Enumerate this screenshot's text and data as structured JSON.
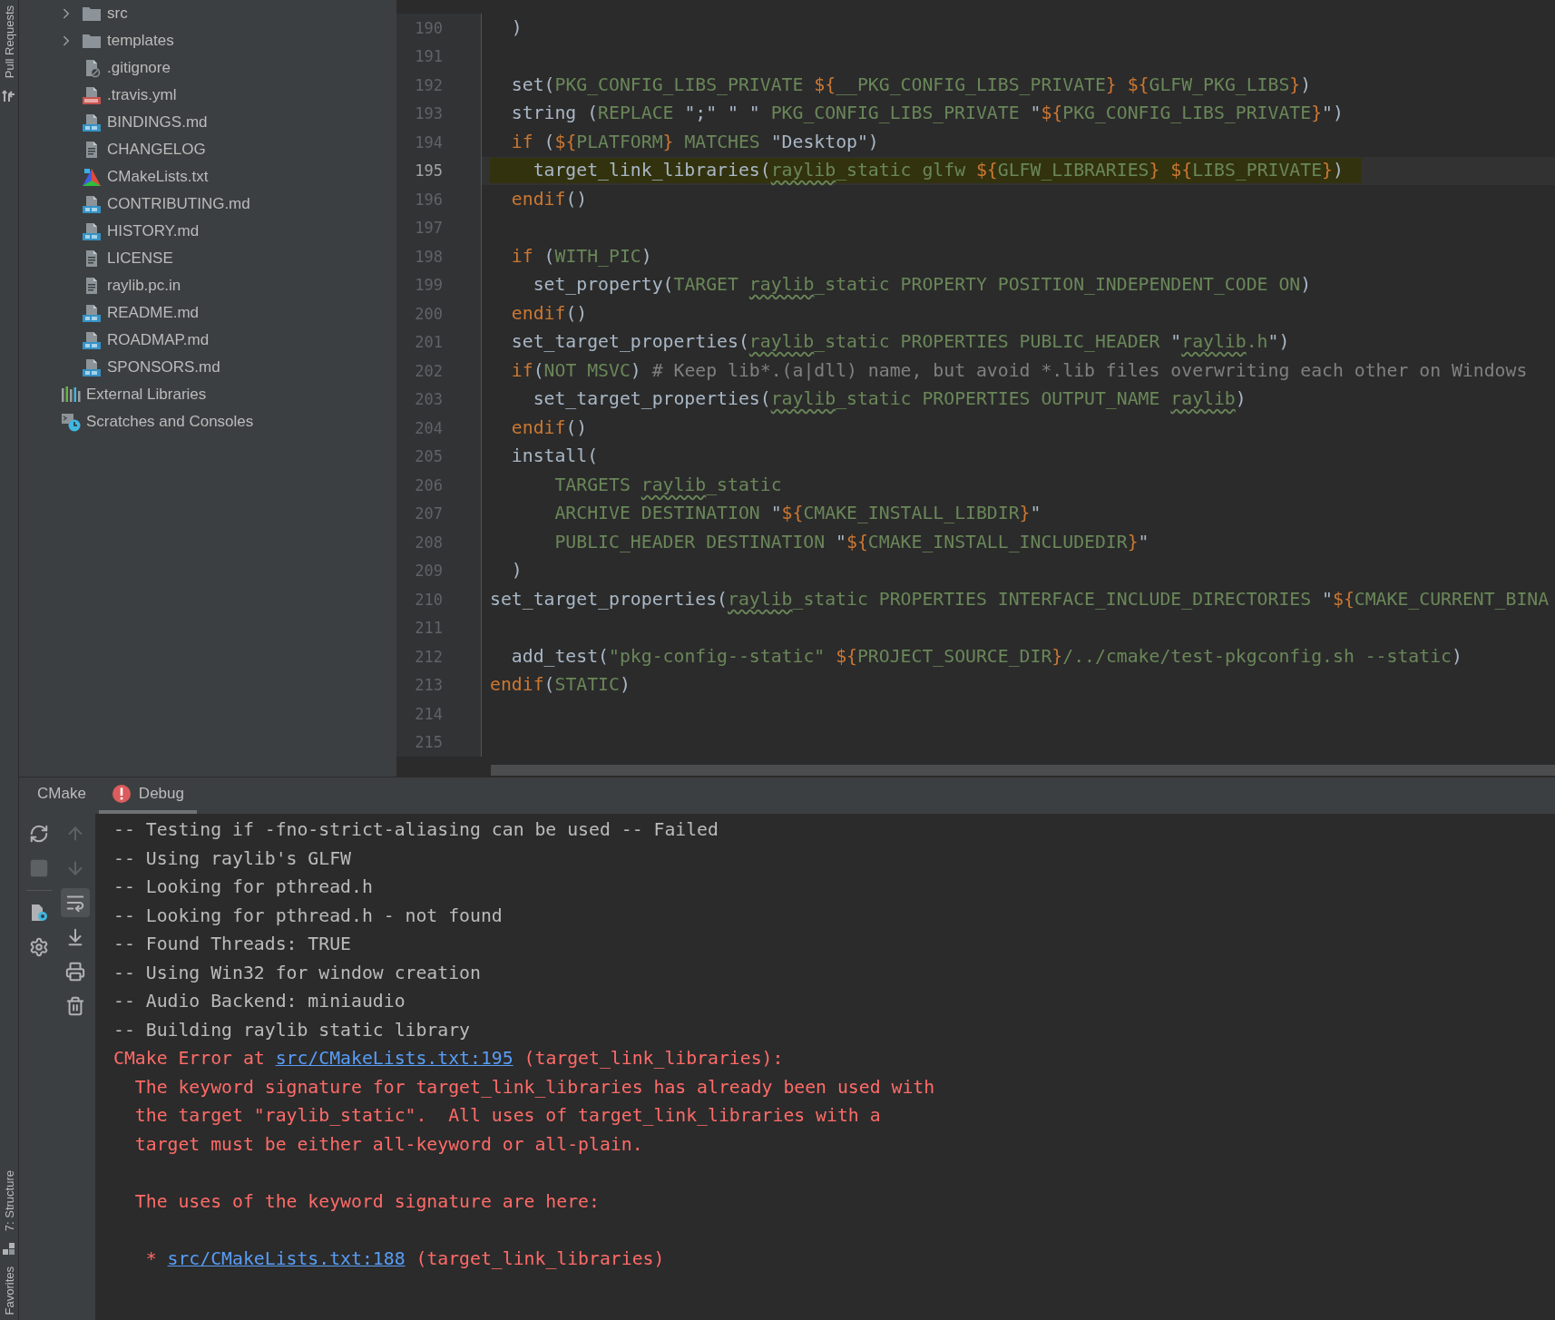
{
  "side_stripe": {
    "top": [
      {
        "label": "Pull Requests",
        "kind": "pull_requests"
      }
    ],
    "bottom": [
      {
        "label": "7: Structure",
        "kind": "structure"
      },
      {
        "label": "Favorites",
        "kind": "favorites"
      }
    ]
  },
  "project_tree": {
    "files": [
      {
        "label": "src",
        "kind": "folder",
        "expanded": false
      },
      {
        "label": "templates",
        "kind": "folder",
        "expanded": false
      },
      {
        "label": ".gitignore",
        "kind": "ignore"
      },
      {
        "label": ".travis.yml",
        "kind": "yml"
      },
      {
        "label": "BINDINGS.md",
        "kind": "md"
      },
      {
        "label": "CHANGELOG",
        "kind": "text"
      },
      {
        "label": "CMakeLists.txt",
        "kind": "cmake"
      },
      {
        "label": "CONTRIBUTING.md",
        "kind": "md"
      },
      {
        "label": "HISTORY.md",
        "kind": "md"
      },
      {
        "label": "LICENSE",
        "kind": "text"
      },
      {
        "label": "raylib.pc.in",
        "kind": "text"
      },
      {
        "label": "README.md",
        "kind": "md"
      },
      {
        "label": "ROADMAP.md",
        "kind": "md"
      },
      {
        "label": "SPONSORS.md",
        "kind": "md"
      }
    ],
    "roots": [
      {
        "label": "External Libraries",
        "kind": "libraries"
      },
      {
        "label": "Scratches and Consoles",
        "kind": "scratches"
      }
    ]
  },
  "editor": {
    "lines": [
      {
        "number": "190",
        "current": false,
        "highlight": false,
        "segments": [
          {
            "text": "  )",
            "kind": "cmd"
          }
        ]
      },
      {
        "number": "191",
        "current": false
      },
      {
        "number": "192",
        "current": false,
        "highlight": false,
        "segments": [
          {
            "text": "  set(",
            "kind": "cmd"
          },
          {
            "text": "PKG_CONFIG_LIBS_PRIVATE ",
            "kind": "arg"
          },
          {
            "text": "${",
            "kind": "dollar"
          },
          {
            "text": "__PKG_CONFIG_LIBS_PRIVATE",
            "kind": "arg"
          },
          {
            "text": "} ",
            "kind": "dollar"
          },
          {
            "text": "${",
            "kind": "dollar"
          },
          {
            "text": "GLFW_PKG_LIBS",
            "kind": "arg"
          },
          {
            "text": "}",
            "kind": "dollar"
          },
          {
            "text": ")",
            "kind": "cmd"
          }
        ]
      },
      {
        "number": "193",
        "current": false,
        "highlight": false,
        "segments": [
          {
            "text": "  string (",
            "kind": "cmd"
          },
          {
            "text": "REPLACE ",
            "kind": "arg"
          },
          {
            "text": "\";\" \" \"",
            "kind": "cmd"
          },
          {
            "text": " PKG_CONFIG_LIBS_PRIVATE ",
            "kind": "arg"
          },
          {
            "text": "\"",
            "kind": "cmd"
          },
          {
            "text": "${",
            "kind": "dollar"
          },
          {
            "text": "PKG_CONFIG_LIBS_PRIVATE",
            "kind": "arg"
          },
          {
            "text": "}",
            "kind": "dollar"
          },
          {
            "text": "\")",
            "kind": "cmd"
          }
        ]
      },
      {
        "number": "194",
        "current": false,
        "highlight": false,
        "segments": [
          {
            "text": "  if",
            "kind": "keyword"
          },
          {
            "text": " (",
            "kind": "cmd"
          },
          {
            "text": "${",
            "kind": "dollar"
          },
          {
            "text": "PLATFORM",
            "kind": "arg"
          },
          {
            "text": "}",
            "kind": "dollar"
          },
          {
            "text": " MATCHES ",
            "kind": "arg"
          },
          {
            "text": "\"Desktop\")",
            "kind": "cmd"
          }
        ]
      },
      {
        "number": "195",
        "current": true,
        "highlight": true,
        "segments": [
          {
            "text": "    target_link_libraries(",
            "kind": "cmd"
          },
          {
            "text": "raylib",
            "kind": "typo"
          },
          {
            "text": "_static glfw ",
            "kind": "arg"
          },
          {
            "text": "${",
            "kind": "dollar"
          },
          {
            "text": "GLFW_LIBRARIES",
            "kind": "arg"
          },
          {
            "text": "} ",
            "kind": "dollar"
          },
          {
            "text": "${",
            "kind": "dollar"
          },
          {
            "text": "LIBS_PRIVATE",
            "kind": "arg"
          },
          {
            "text": "}",
            "kind": "dollar"
          },
          {
            "text": ")",
            "kind": "cmd"
          }
        ]
      },
      {
        "number": "196",
        "current": false,
        "highlight": false,
        "segments": [
          {
            "text": "  endif",
            "kind": "keyword"
          },
          {
            "text": "()",
            "kind": "cmd"
          }
        ]
      },
      {
        "number": "197",
        "current": false
      },
      {
        "number": "198",
        "current": false,
        "highlight": false,
        "segments": [
          {
            "text": "  if",
            "kind": "keyword"
          },
          {
            "text": " (",
            "kind": "cmd"
          },
          {
            "text": "WITH_PIC",
            "kind": "arg"
          },
          {
            "text": ")",
            "kind": "cmd"
          }
        ]
      },
      {
        "number": "199",
        "current": false,
        "highlight": false,
        "segments": [
          {
            "text": "    set_property(",
            "kind": "cmd"
          },
          {
            "text": "TARGET ",
            "kind": "arg"
          },
          {
            "text": "raylib",
            "kind": "typo"
          },
          {
            "text": "_static PROPERTY POSITION_INDEPENDENT_CODE ON",
            "kind": "arg"
          },
          {
            "text": ")",
            "kind": "cmd"
          }
        ]
      },
      {
        "number": "200",
        "current": false,
        "highlight": false,
        "segments": [
          {
            "text": "  endif",
            "kind": "keyword"
          },
          {
            "text": "()",
            "kind": "cmd"
          }
        ]
      },
      {
        "number": "201",
        "current": false,
        "highlight": false,
        "segments": [
          {
            "text": "  set_target_properties(",
            "kind": "cmd"
          },
          {
            "text": "raylib",
            "kind": "typo"
          },
          {
            "text": "_static PROPERTIES PUBLIC_HEADER ",
            "kind": "arg"
          },
          {
            "text": "\"",
            "kind": "cmd"
          },
          {
            "text": "raylib",
            "kind": "typo"
          },
          {
            "text": ".h",
            "kind": "arg"
          },
          {
            "text": "\")",
            "kind": "cmd"
          }
        ]
      },
      {
        "number": "202",
        "current": false,
        "highlight": false,
        "segments": [
          {
            "text": "  if",
            "kind": "keyword"
          },
          {
            "text": "(",
            "kind": "cmd"
          },
          {
            "text": "NOT MSVC",
            "kind": "arg"
          },
          {
            "text": ") ",
            "kind": "cmd"
          },
          {
            "text": "# Keep lib*.(a|dll) name, but avoid *.lib files overwriting each other on Windows",
            "kind": "comment"
          }
        ]
      },
      {
        "number": "203",
        "current": false,
        "highlight": false,
        "segments": [
          {
            "text": "    set_target_properties(",
            "kind": "cmd"
          },
          {
            "text": "raylib",
            "kind": "typo"
          },
          {
            "text": "_static PROPERTIES OUTPUT_NAME ",
            "kind": "arg"
          },
          {
            "text": "raylib",
            "kind": "typo"
          },
          {
            "text": ")",
            "kind": "cmd"
          }
        ]
      },
      {
        "number": "204",
        "current": false,
        "highlight": false,
        "segments": [
          {
            "text": "  endif",
            "kind": "keyword"
          },
          {
            "text": "()",
            "kind": "cmd"
          }
        ]
      },
      {
        "number": "205",
        "current": false,
        "highlight": false,
        "segments": [
          {
            "text": "  install(",
            "kind": "cmd"
          }
        ]
      },
      {
        "number": "206",
        "current": false,
        "highlight": false,
        "segments": [
          {
            "text": "      TARGETS ",
            "kind": "arg"
          },
          {
            "text": "raylib",
            "kind": "typo"
          },
          {
            "text": "_static",
            "kind": "arg"
          }
        ]
      },
      {
        "number": "207",
        "current": false,
        "highlight": false,
        "segments": [
          {
            "text": "      ARCHIVE DESTINATION ",
            "kind": "arg"
          },
          {
            "text": "\"",
            "kind": "cmd"
          },
          {
            "text": "${",
            "kind": "dollar"
          },
          {
            "text": "CMAKE_INSTALL_LIBDIR",
            "kind": "arg"
          },
          {
            "text": "}",
            "kind": "dollar"
          },
          {
            "text": "\"",
            "kind": "cmd"
          }
        ]
      },
      {
        "number": "208",
        "current": false,
        "highlight": false,
        "segments": [
          {
            "text": "      PUBLIC_HEADER DESTINATION ",
            "kind": "arg"
          },
          {
            "text": "\"",
            "kind": "cmd"
          },
          {
            "text": "${",
            "kind": "dollar"
          },
          {
            "text": "CMAKE_INSTALL_INCLUDEDIR",
            "kind": "arg"
          },
          {
            "text": "}",
            "kind": "dollar"
          },
          {
            "text": "\"",
            "kind": "cmd"
          }
        ]
      },
      {
        "number": "209",
        "current": false,
        "highlight": false,
        "segments": [
          {
            "text": "  )",
            "kind": "cmd"
          }
        ]
      },
      {
        "number": "210",
        "current": false,
        "highlight": false,
        "segments": [
          {
            "text": "set_target_properties(",
            "kind": "cmd"
          },
          {
            "text": "raylib",
            "kind": "typo"
          },
          {
            "text": "_static PROPERTIES INTERFACE_INCLUDE_DIRECTORIES ",
            "kind": "arg"
          },
          {
            "text": "\"",
            "kind": "cmd"
          },
          {
            "text": "${",
            "kind": "dollar"
          },
          {
            "text": "CMAKE_CURRENT_BINA",
            "kind": "arg"
          }
        ]
      },
      {
        "number": "211",
        "current": false
      },
      {
        "number": "212",
        "current": false,
        "highlight": false,
        "segments": [
          {
            "text": "  add_test(",
            "kind": "cmd"
          },
          {
            "text": "\"pkg-config--static\" ",
            "kind": "arg"
          },
          {
            "text": "${",
            "kind": "dollar"
          },
          {
            "text": "PROJECT_SOURCE_DIR",
            "kind": "arg"
          },
          {
            "text": "}",
            "kind": "dollar"
          },
          {
            "text": "/../cmake/test-pkgconfig.sh --static",
            "kind": "arg"
          },
          {
            "text": ")",
            "kind": "cmd"
          }
        ]
      },
      {
        "number": "213",
        "current": false,
        "highlight": false,
        "segments": [
          {
            "text": "endif",
            "kind": "keyword"
          },
          {
            "text": "(",
            "kind": "cmd"
          },
          {
            "text": "STATIC",
            "kind": "arg"
          },
          {
            "text": ")",
            "kind": "cmd"
          }
        ]
      },
      {
        "number": "214",
        "current": false
      },
      {
        "number": "215",
        "current": false
      }
    ]
  },
  "bottom_panel": {
    "tabs": [
      {
        "label": "CMake",
        "selected": false,
        "error": false
      },
      {
        "label": "Debug",
        "selected": true,
        "error": true
      }
    ],
    "toolbar": [
      [
        {
          "kind": "reload",
          "disabled": false,
          "selected": false
        },
        {
          "kind": "stop",
          "disabled": true,
          "selected": false
        },
        {
          "kind": "divider"
        },
        {
          "kind": "cmake_settings",
          "disabled": false,
          "selected": false
        },
        {
          "kind": "settings",
          "disabled": false,
          "selected": false
        }
      ],
      [
        {
          "kind": "up",
          "disabled": true,
          "selected": false
        },
        {
          "kind": "down",
          "disabled": true,
          "selected": false
        },
        {
          "kind": "soft_wrap",
          "disabled": false,
          "selected": true
        },
        {
          "kind": "scroll_end",
          "disabled": false,
          "selected": false
        },
        {
          "kind": "print",
          "disabled": false,
          "selected": false
        },
        {
          "kind": "clear",
          "disabled": false,
          "selected": false
        }
      ]
    ],
    "console": [
      {
        "gap_before": false,
        "segments": [
          {
            "text": "-- Testing if -fno-strict-aliasing can be used -- Failed",
            "kind": "info"
          }
        ]
      },
      {
        "gap_before": false,
        "segments": [
          {
            "text": "-- Using raylib's GLFW",
            "kind": "info"
          }
        ]
      },
      {
        "gap_before": false,
        "segments": [
          {
            "text": "-- Looking for pthread.h",
            "kind": "info"
          }
        ]
      },
      {
        "gap_before": false,
        "segments": [
          {
            "text": "-- Looking for pthread.h - not found",
            "kind": "info"
          }
        ]
      },
      {
        "gap_before": false,
        "segments": [
          {
            "text": "-- Found Threads: TRUE",
            "kind": "info"
          }
        ]
      },
      {
        "gap_before": false,
        "segments": [
          {
            "text": "-- Using Win32 for window creation",
            "kind": "info"
          }
        ]
      },
      {
        "gap_before": false,
        "segments": [
          {
            "text": "-- Audio Backend: miniaudio",
            "kind": "info"
          }
        ]
      },
      {
        "gap_before": false,
        "segments": [
          {
            "text": "-- Building raylib static library",
            "kind": "info"
          }
        ]
      },
      {
        "gap_before": false,
        "segments": [
          {
            "text": "CMake Error at ",
            "kind": "error"
          },
          {
            "text": "src/CMakeLists.txt:195",
            "kind": "link"
          },
          {
            "text": " (target_link_libraries):",
            "kind": "error"
          }
        ]
      },
      {
        "gap_before": false,
        "segments": [
          {
            "text": "  The keyword signature for target_link_libraries has already been used with",
            "kind": "error"
          }
        ]
      },
      {
        "gap_before": false,
        "segments": [
          {
            "text": "  the target \"raylib_static\".  All uses of target_link_libraries with a",
            "kind": "error"
          }
        ]
      },
      {
        "gap_before": false,
        "segments": [
          {
            "text": "  target must be either all-keyword or all-plain.",
            "kind": "error"
          }
        ]
      },
      {
        "gap_before": true,
        "segments": [
          {
            "text": "  The uses of the keyword signature are here:",
            "kind": "error"
          }
        ]
      },
      {
        "gap_before": true,
        "segments": [
          {
            "text": "   * ",
            "kind": "error"
          },
          {
            "text": "src/CMakeLists.txt:188",
            "kind": "link"
          },
          {
            "text": " (target_link_libraries)",
            "kind": "error"
          }
        ]
      }
    ]
  }
}
